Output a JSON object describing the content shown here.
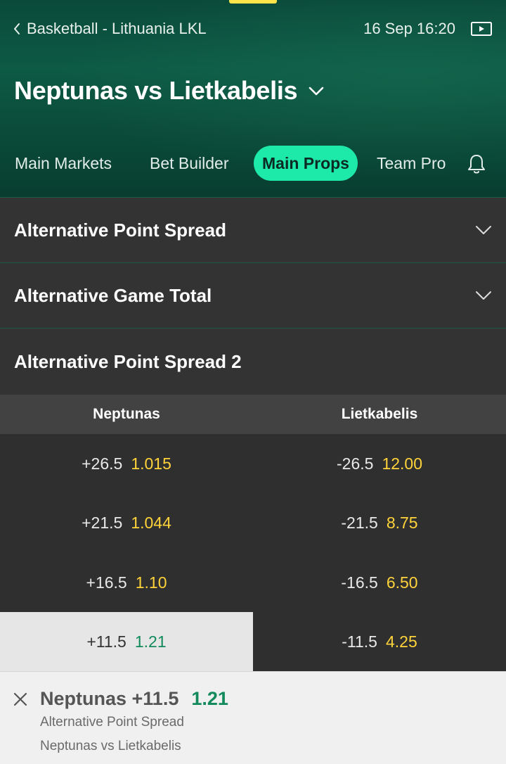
{
  "header": {
    "breadcrumb": "Basketball - Lithuania LKL",
    "datetime": "16 Sep 16:20",
    "match_title": "Neptunas vs Lietkabelis"
  },
  "tabs": [
    {
      "label": "Main Markets",
      "active": false
    },
    {
      "label": "Bet Builder",
      "active": false
    },
    {
      "label": "Main Props",
      "active": true
    },
    {
      "label": "Team Pro",
      "active": false
    }
  ],
  "sections": [
    {
      "title": "Alternative Point Spread",
      "expanded": false
    },
    {
      "title": "Alternative Game Total",
      "expanded": false
    },
    {
      "title": "Alternative Point Spread 2",
      "expanded": true
    }
  ],
  "table": {
    "columns": [
      "Neptunas",
      "Lietkabelis"
    ],
    "rows": [
      {
        "home": {
          "line": "+26.5",
          "price": "1.015"
        },
        "away": {
          "line": "-26.5",
          "price": "12.00"
        }
      },
      {
        "home": {
          "line": "+21.5",
          "price": "1.044"
        },
        "away": {
          "line": "-21.5",
          "price": "8.75"
        }
      },
      {
        "home": {
          "line": "+16.5",
          "price": "1.10"
        },
        "away": {
          "line": "-16.5",
          "price": "6.50"
        }
      },
      {
        "home": {
          "line": "+11.5",
          "price": "1.21",
          "selected": true
        },
        "away": {
          "line": "-11.5",
          "price": "4.25"
        }
      }
    ]
  },
  "betslip": {
    "selection": "Neptunas +11.5",
    "price": "1.21",
    "market": "Alternative Point Spread",
    "event": "Neptunas vs Lietkabelis"
  },
  "colors": {
    "accent": "#1de9a8",
    "odds": "#ffd33a",
    "selected_price": "#128a5c",
    "header_green": "#0d5a45"
  },
  "icons": [
    "back-icon",
    "tv-icon",
    "chevron-down-icon",
    "bell-icon",
    "close-icon"
  ]
}
